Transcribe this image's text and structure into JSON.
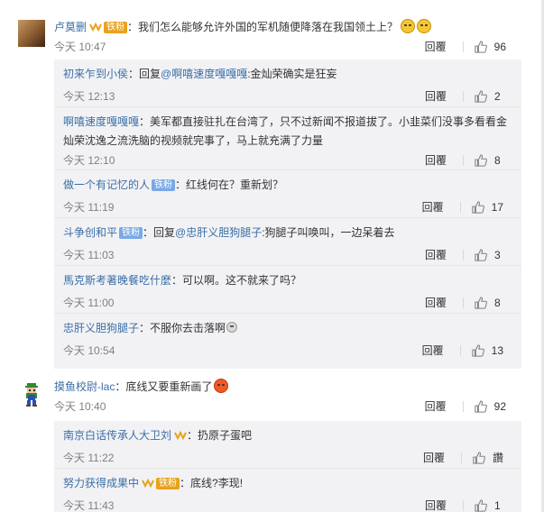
{
  "reply_label": "回覆",
  "comments": [
    {
      "user": "卢莫删",
      "badge": "铁粉",
      "text": "：我们怎么能够允许外国的军机随便降落在我国领土上？",
      "time": "今天 10:47",
      "likes": "96",
      "emoji": [
        "laugh-emoji",
        "laugh-emoji"
      ],
      "replies": [
        {
          "user": "初来乍到小侯",
          "prefix": "：回复",
          "mention": "@啊嘻速度嘎嘎嘎",
          "text": ":金灿荣确实是狂妄",
          "time": "今天 12:13",
          "likes": "2"
        },
        {
          "user": "啊嘻速度嘎嘎嘎",
          "text": "：美军都直接驻扎在台湾了，只不过新闻不报道拔了。小韭菜们没事多看看金灿荣沈逸之流洗脑的视频就完事了，马上就充满了力量",
          "time": "今天 12:10",
          "likes": "8"
        },
        {
          "user": "做一个有记忆的人",
          "badge": "铁粉",
          "text": "：红线何在？重新划？",
          "time": "今天 11:19",
          "likes": "17"
        },
        {
          "user": "斗争创和平",
          "badge": "铁粉",
          "prefix": "：回复",
          "mention": "@忠肝义胆狗腿子",
          "text": ":狗腿子叫唤叫，一边呆着去",
          "time": "今天 11:03",
          "likes": "3"
        },
        {
          "user": "馬克斯考著晚餐吃什麼",
          "text": "：可以啊。这不就来了吗？",
          "time": "今天 11:00",
          "likes": "8"
        },
        {
          "user": "忠肝义胆狗腿子",
          "text": "：不服你去击落啊",
          "time": "今天 10:54",
          "likes": "13",
          "emoji": "smile-emoji"
        }
      ]
    },
    {
      "user": "摸鱼校尉-lac",
      "text": "：底线又要重新画了",
      "time": "今天 10:40",
      "likes": "92",
      "emoji": [
        "angry-emoji"
      ],
      "replies": [
        {
          "user": "南京白话传承人大卫刘",
          "text": "：扔原子蛋吧",
          "time": "今天 11:22",
          "likes": "讚"
        },
        {
          "user": "努力获得成果中",
          "badge": "铁粉",
          "text": "：底线?李现!",
          "time": "今天 11:43",
          "likes": "1"
        }
      ]
    }
  ]
}
